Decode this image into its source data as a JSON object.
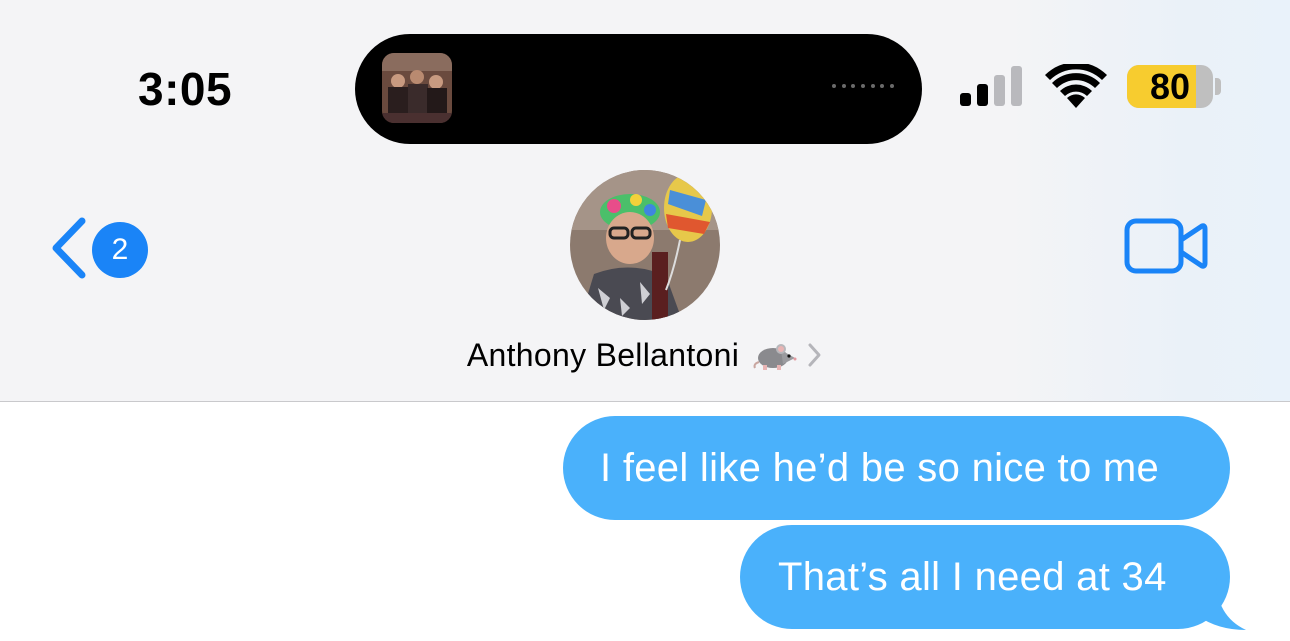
{
  "status_bar": {
    "time": "3:05",
    "battery_percent": "80",
    "battery_level": 0.8,
    "icons": [
      "album-art-thumbnail",
      "cellular-signal-icon",
      "wifi-icon",
      "battery-icon"
    ],
    "signal_bars_active": 2,
    "battery_color": "#f7cc2f"
  },
  "nav": {
    "back_icon": "chevron-left-icon",
    "unread_count": "2",
    "contact_name": "Anthony Bellantoni",
    "contact_emoji": "rat-emoji",
    "details_icon": "chevron-right-icon",
    "video_icon": "video-camera-icon",
    "accent_color": "#1a84f7"
  },
  "messages": [
    {
      "direction": "sent",
      "text": "I feel like he’d be so nice to me"
    },
    {
      "direction": "sent",
      "text": "That’s all I need at 34"
    }
  ],
  "colors": {
    "sent_bubble": "#4ab1fb",
    "header_bg": "#f4f4f6"
  }
}
